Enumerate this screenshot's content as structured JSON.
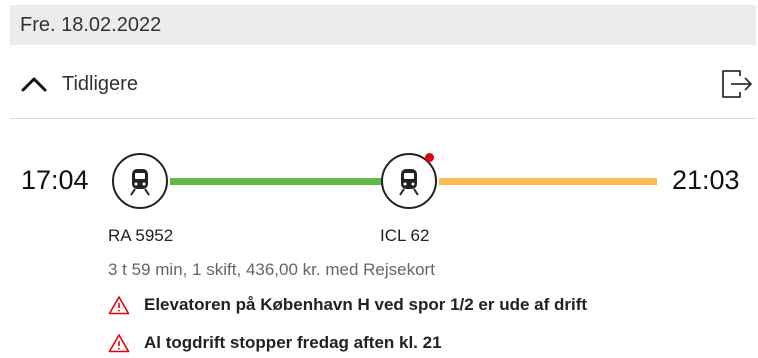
{
  "date_header": "Fre. 18.02.2022",
  "earlier": {
    "label": "Tidligere",
    "icon": "chevron-up-icon"
  },
  "export": {
    "icon": "export-icon"
  },
  "journey": {
    "departure_time": "17:04",
    "arrival_time": "21:03",
    "legs": [
      {
        "label": "RA 5952",
        "icon": "train-icon",
        "line_color": "#5dbb46"
      },
      {
        "label": "ICL 62",
        "icon": "train-icon",
        "line_color": "#fbbd4f",
        "has_notice": true
      }
    ],
    "summary": "3 t 59 min, 1 skift, 436,00 kr. med Rejsekort"
  },
  "alerts": [
    {
      "icon": "warning-icon",
      "text": "Elevatoren på København H ved spor 1/2 er ude af drift"
    },
    {
      "icon": "warning-icon",
      "text": "Al togdrift stopper fredag aften kl. 21"
    }
  ],
  "colors": {
    "notice_dot": "#e3000f",
    "warning": "#e3000f",
    "header_bg": "#ececec"
  }
}
